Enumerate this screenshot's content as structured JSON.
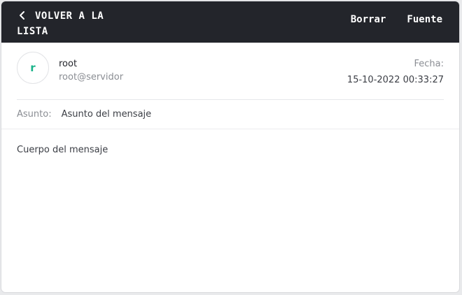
{
  "topbar": {
    "back_line1": "Volver a la",
    "back_line2": "Lista",
    "delete_label": "Borrar",
    "source_label": "Fuente"
  },
  "message": {
    "avatar_letter": "r",
    "sender_name": "root",
    "sender_email": "root@servidor",
    "date_label": "Fecha:",
    "date_value": "15-10-2022 00:33:27",
    "subject_label": "Asunto:",
    "subject_value": "Asunto del mensaje",
    "body": "Cuerpo del mensaje"
  },
  "colors": {
    "topbar_bg": "#23252b",
    "avatar_accent": "#1ab38a"
  },
  "icons": {
    "back": "chevron-left-icon"
  }
}
